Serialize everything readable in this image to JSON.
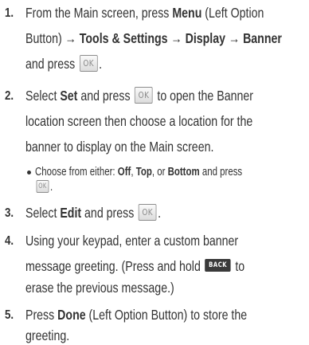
{
  "steps": [
    {
      "number": "1.",
      "lines": [
        [
          "From the Main screen, press ",
          "Menu",
          " (Left Option"
        ],
        [
          "Button) ",
          "→ Tools & Settings → Display → Banner"
        ],
        [
          "and press "
        ]
      ]
    },
    {
      "number": "2.",
      "lines": [
        [
          "Select ",
          "Set",
          " and press ",
          " to open the Banner"
        ],
        [
          "location screen then choose a location for the"
        ],
        [
          "banner to display on the Main screen."
        ]
      ],
      "sub": [
        [
          "Choose from either: ",
          "Off",
          ", ",
          "Top",
          ", or ",
          "Bottom",
          " and press"
        ]
      ]
    },
    {
      "number": "3.",
      "lines": [
        [
          "Select ",
          "Edit",
          " and press "
        ]
      ]
    },
    {
      "number": "4.",
      "lines": [
        [
          "Using your keypad, enter a custom banner"
        ],
        [
          "message greeting. (Press and hold ",
          " to"
        ],
        [
          "erase the previous message.)"
        ]
      ]
    },
    {
      "number": "5.",
      "lines": [
        [
          "Press ",
          "Done",
          " (Left Option Button) to store the"
        ],
        [
          "greeting."
        ]
      ]
    }
  ],
  "keys": {
    "ok": "OK",
    "back": "BACK"
  },
  "punctuation": {
    "period": "."
  }
}
